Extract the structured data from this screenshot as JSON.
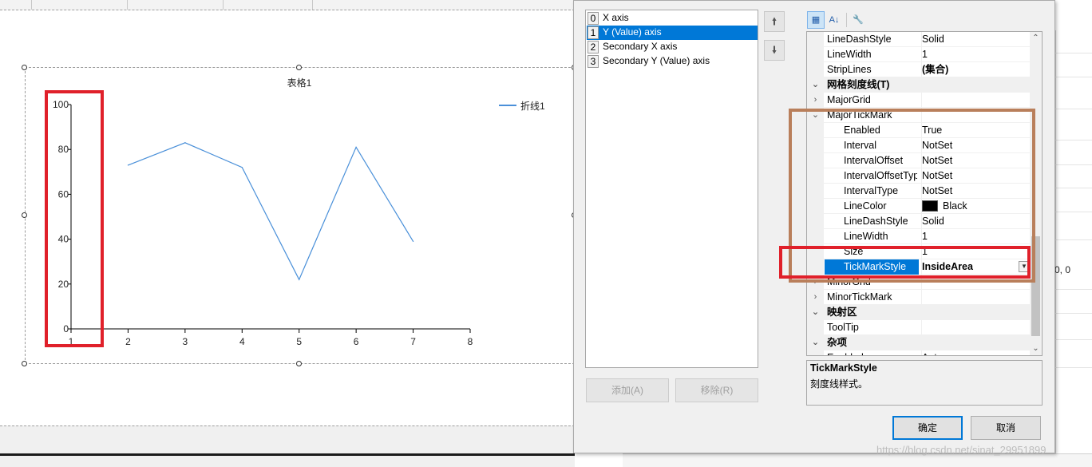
{
  "chart": {
    "title": "表格1",
    "legend_label": "折线1",
    "y_tick_labels": [
      "100",
      "80",
      "60",
      "40",
      "20",
      "0"
    ],
    "x_tick_labels": [
      "1",
      "2",
      "3",
      "4",
      "5",
      "6",
      "7",
      "8"
    ]
  },
  "chart_data": {
    "type": "line",
    "title": "表格1",
    "xlabel": "",
    "ylabel": "",
    "xlim": [
      1,
      8
    ],
    "ylim": [
      0,
      100
    ],
    "legend": "top-right",
    "grid": false,
    "series": [
      {
        "name": "折线1",
        "color": "#4a90d9",
        "x": [
          2,
          3,
          4,
          5,
          6,
          7
        ],
        "values": [
          73,
          83,
          72,
          22,
          81,
          39
        ]
      }
    ]
  },
  "axis_list": {
    "items": [
      {
        "index": "0",
        "label": "X axis"
      },
      {
        "index": "1",
        "label": "Y (Value) axis"
      },
      {
        "index": "2",
        "label": "Secondary X axis"
      },
      {
        "index": "3",
        "label": "Secondary Y (Value) axis"
      }
    ],
    "selected_index": 1,
    "add_label": "添加(A)",
    "remove_label": "移除(R)",
    "up_icon": "arrow-up-icon",
    "down_icon": "arrow-down-icon"
  },
  "property_grid": {
    "toolbar_icons": [
      "categorized-icon",
      "alphabetical-icon",
      "property-pages-icon"
    ],
    "rows": [
      {
        "name": "LineDashStyle",
        "value": "Solid"
      },
      {
        "name": "LineWidth",
        "value": "1"
      },
      {
        "name": "StripLines",
        "value": "(集合)",
        "value_bold": true
      },
      {
        "name": "网格刻度线(T)",
        "category": true
      },
      {
        "name": "MajorGrid",
        "expand": "collapsed"
      },
      {
        "name": "MajorTickMark",
        "expand": "expanded"
      },
      {
        "name": "Enabled",
        "value": "True",
        "sub": true
      },
      {
        "name": "Interval",
        "value": "NotSet",
        "sub": true
      },
      {
        "name": "IntervalOffset",
        "value": "NotSet",
        "sub": true
      },
      {
        "name": "IntervalOffsetType",
        "value": "NotSet",
        "sub": true
      },
      {
        "name": "IntervalType",
        "value": "NotSet",
        "sub": true
      },
      {
        "name": "LineColor",
        "value": "Black",
        "sub": true,
        "swatch": "#000000"
      },
      {
        "name": "LineDashStyle",
        "value": "Solid",
        "sub": true
      },
      {
        "name": "LineWidth",
        "value": "1",
        "sub": true
      },
      {
        "name": "Size",
        "value": "1",
        "sub": true
      },
      {
        "name": "TickMarkStyle",
        "value": "InsideArea",
        "sub": true,
        "selected": true,
        "value_bold": true,
        "dropdown": true
      },
      {
        "name": "MinorGrid",
        "expand": "collapsed"
      },
      {
        "name": "MinorTickMark",
        "expand": "collapsed"
      },
      {
        "name": "映射区",
        "category": true
      },
      {
        "name": "ToolTip",
        "value": ""
      },
      {
        "name": "杂项",
        "category": true
      },
      {
        "name": "Enabled",
        "value": "Auto"
      }
    ]
  },
  "description": {
    "title": "TickMarkStyle",
    "text": "刻度线样式。"
  },
  "buttons": {
    "ok": "确定",
    "cancel": "取消"
  },
  "background": {
    "right_text": "0, 0",
    "watermark": "https://blog.csdn.net/sinat_29951899"
  },
  "colors": {
    "accent": "#0078d7",
    "annotation_red": "#e0202a",
    "annotation_brown": "#b97f5b",
    "series_line": "#4a90d9"
  }
}
